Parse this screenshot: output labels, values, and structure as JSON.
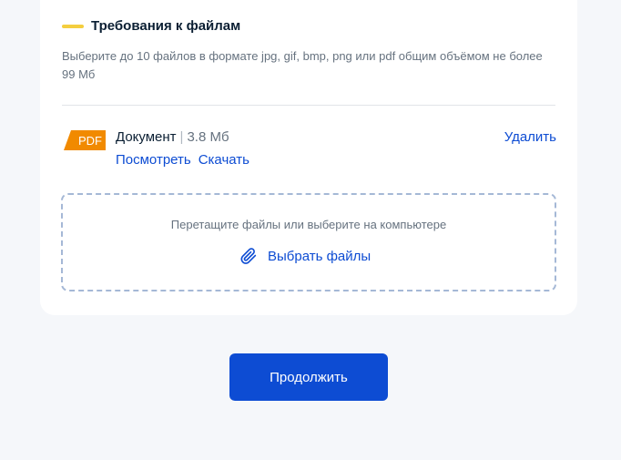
{
  "requirements": {
    "title": "Требования к файлам",
    "description": "Выберите до 10 файлов в формате jpg, gif, bmp, png или pdf общим объёмом не более 99 Мб"
  },
  "file": {
    "type_badge": "PDF",
    "name": "Документ",
    "separator": "|",
    "size": "3.8 Мб",
    "view_label": "Посмотреть",
    "download_label": "Скачать",
    "delete_label": "Удалить"
  },
  "dropzone": {
    "hint": "Перетащите файлы или выберите на компьютере",
    "choose_label": "Выбрать файлы"
  },
  "actions": {
    "continue_label": "Продолжить"
  },
  "colors": {
    "accent_bar": "#f4ce3f",
    "link": "#0d4cd3",
    "primary_button": "#0d4cd3",
    "pdf_badge": "#f18a00"
  },
  "icons": {
    "pdf": "pdf-file-icon",
    "clip": "paperclip-icon"
  }
}
